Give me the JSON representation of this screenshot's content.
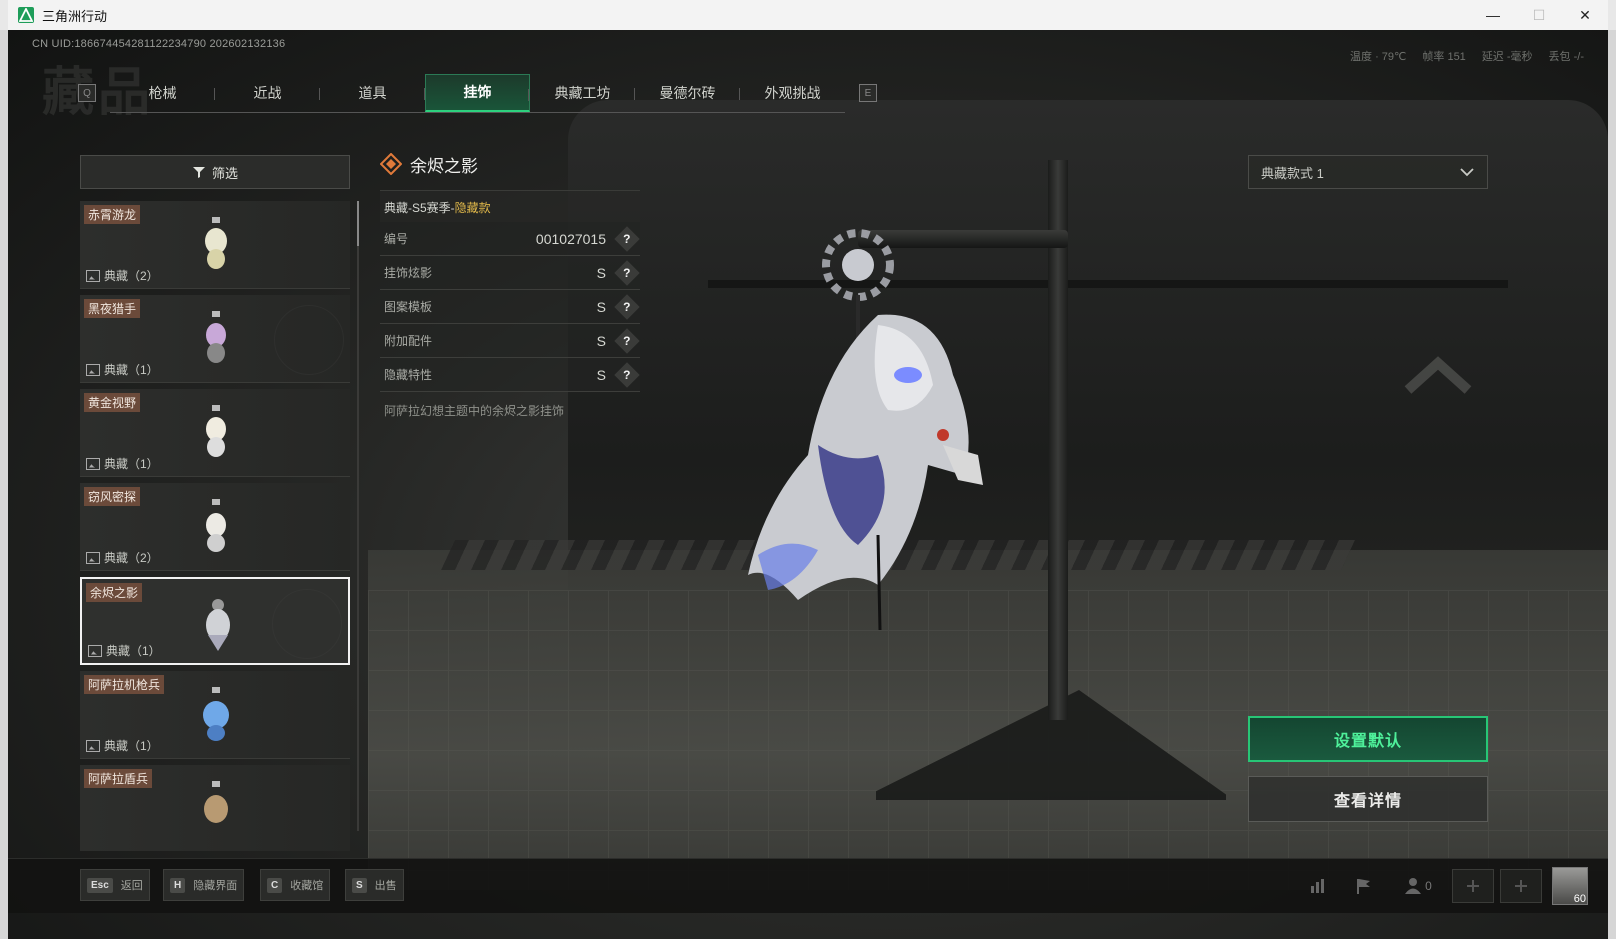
{
  "window": {
    "title": "三角洲行动",
    "minimize": "—",
    "maximize": "☐",
    "close": "✕"
  },
  "hud": {
    "uid": "CN UID:186674454281122234790 202602132136",
    "temp": "温度 · 79℃",
    "fps": "帧率 151",
    "latency": "延迟 -毫秒",
    "loss": "丢包 -/-",
    "watermark": "藏品"
  },
  "tabs": {
    "prev_key": "Q",
    "next_key": "E",
    "items": [
      {
        "label": "枪械"
      },
      {
        "label": "近战"
      },
      {
        "label": "道具"
      },
      {
        "label": "挂饰"
      },
      {
        "label": "典藏工坊"
      },
      {
        "label": "曼德尔砖"
      },
      {
        "label": "外观挑战"
      }
    ],
    "active_index": 3
  },
  "filter": {
    "label": "筛选"
  },
  "list": {
    "items": [
      {
        "name": "赤霄游龙",
        "count": "典藏（2）"
      },
      {
        "name": "黑夜猎手",
        "count": "典藏（1）"
      },
      {
        "name": "黄金视野",
        "count": "典藏（1）"
      },
      {
        "name": "窃风密探",
        "count": "典藏（2）"
      },
      {
        "name": "余烬之影",
        "count": "典藏（1）"
      },
      {
        "name": "阿萨拉机枪兵",
        "count": "典藏（1）"
      },
      {
        "name": "阿萨拉盾兵",
        "count": ""
      }
    ],
    "selected_index": 4
  },
  "detail": {
    "title": "余烬之影",
    "subtitle_prefix": "典藏-S5赛季-",
    "subtitle_highlight": "隐藏款",
    "attributes": [
      {
        "label": "编号",
        "value": "001027015"
      },
      {
        "label": "挂饰炫影",
        "value": "S"
      },
      {
        "label": "图案模板",
        "value": "S"
      },
      {
        "label": "附加配件",
        "value": "S"
      },
      {
        "label": "隐藏特性",
        "value": "S"
      }
    ],
    "help_mark": "?",
    "description": "阿萨拉幻想主题中的余烬之影挂饰"
  },
  "style_dropdown": {
    "value": "典藏款式 1"
  },
  "actions": {
    "set_default": "设置默认",
    "view_detail": "查看详情"
  },
  "bottom_bar": {
    "hotkeys": [
      {
        "key": "Esc",
        "label": "返回"
      },
      {
        "key": "H",
        "label": "隐藏界面"
      },
      {
        "key": "C",
        "label": "收藏馆"
      },
      {
        "key": "S",
        "label": "出售"
      }
    ],
    "friends_count": "0",
    "avatar_level": "60"
  },
  "colors": {
    "accent_green": "#27c676",
    "tag_brown": "#6b4a3a",
    "highlight_gold": "#e0b84a"
  }
}
